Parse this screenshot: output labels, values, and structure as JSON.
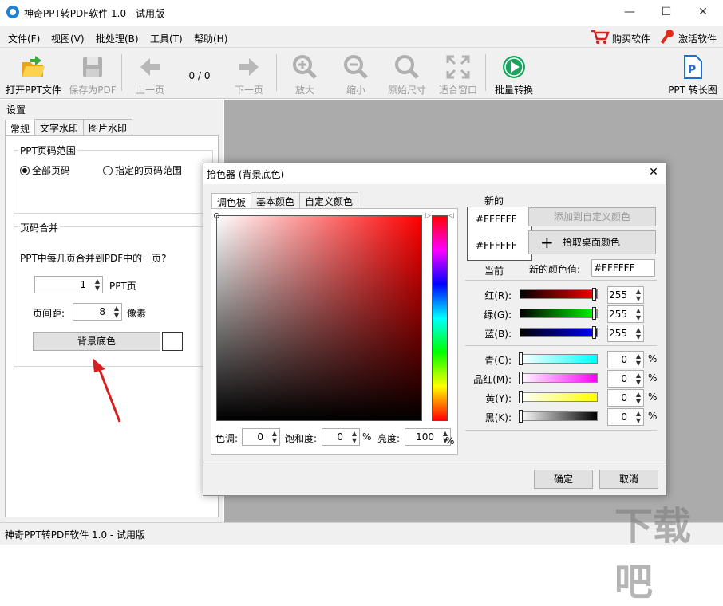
{
  "window": {
    "title": "神奇PPT转PDF软件 1.0 - 试用版",
    "min": "—",
    "max": "☐",
    "close": "✕"
  },
  "menu": [
    "文件(F)",
    "视图(V)",
    "批处理(B)",
    "工具(T)",
    "帮助(H)"
  ],
  "menu_right": {
    "buy": "购买软件",
    "activate": "激活软件"
  },
  "toolbar": {
    "open": "打开PPT文件",
    "save": "保存为PDF",
    "prev": "上一页",
    "page": "0 / 0",
    "next": "下一页",
    "zoom_in": "放大",
    "zoom_out": "缩小",
    "original": "原始尺寸",
    "fit": "适合窗口",
    "batch": "批量转换",
    "long": "PPT 转长图"
  },
  "settings": {
    "title": "设置",
    "tabs": [
      "常规",
      "文字水印",
      "图片水印"
    ],
    "range_group": "PPT页码范围",
    "range_all": "全部页码",
    "range_custom": "指定的页码范围",
    "merge_group": "页码合并",
    "merge_question": "PPT中每几页合并到PDF中的一页?",
    "pages_value": "1",
    "pages_unit": "PPT页",
    "spacing_label": "页间距:",
    "spacing_value": "8",
    "spacing_unit": "像素",
    "bg_button": "背景底色"
  },
  "dialog": {
    "title": "拾色器 (背景底色)",
    "close": "✕",
    "tabs": [
      "调色板",
      "基本颜色",
      "自定义颜色"
    ],
    "new_label": "新的",
    "current_label": "当前",
    "new_hex": "#FFFFFF",
    "current_hex": "#FFFFFF",
    "add_custom": "添加到自定义颜色",
    "pick_desktop": "拾取桌面颜色",
    "new_value_label": "新的颜色值:",
    "new_value": "#FFFFFF",
    "hue_label": "色调:",
    "hue": "0",
    "sat_label": "饱和度:",
    "sat": "0",
    "sat_unit": "%",
    "bright_label": "亮度:",
    "bright": "100",
    "bright_unit": "%",
    "rgb": [
      {
        "label": "红(R):",
        "value": "255",
        "color": "#ff0000"
      },
      {
        "label": "绿(G):",
        "value": "255",
        "color": "#00ff00"
      },
      {
        "label": "蓝(B):",
        "value": "255",
        "color": "#0000ff"
      }
    ],
    "cmyk": [
      {
        "label": "青(C):",
        "value": "0",
        "unit": "%",
        "color": "#00ffff"
      },
      {
        "label": "品红(M):",
        "value": "0",
        "unit": "%",
        "color": "#ff00ff"
      },
      {
        "label": "黄(Y):",
        "value": "0",
        "unit": "%",
        "color": "#ffff00"
      },
      {
        "label": "黑(K):",
        "value": "0",
        "unit": "%",
        "color": "#000000"
      }
    ],
    "ok": "确定",
    "cancel": "取消"
  },
  "status": "神奇PPT转PDF软件 1.0 - 试用版",
  "watermark": "下载吧"
}
